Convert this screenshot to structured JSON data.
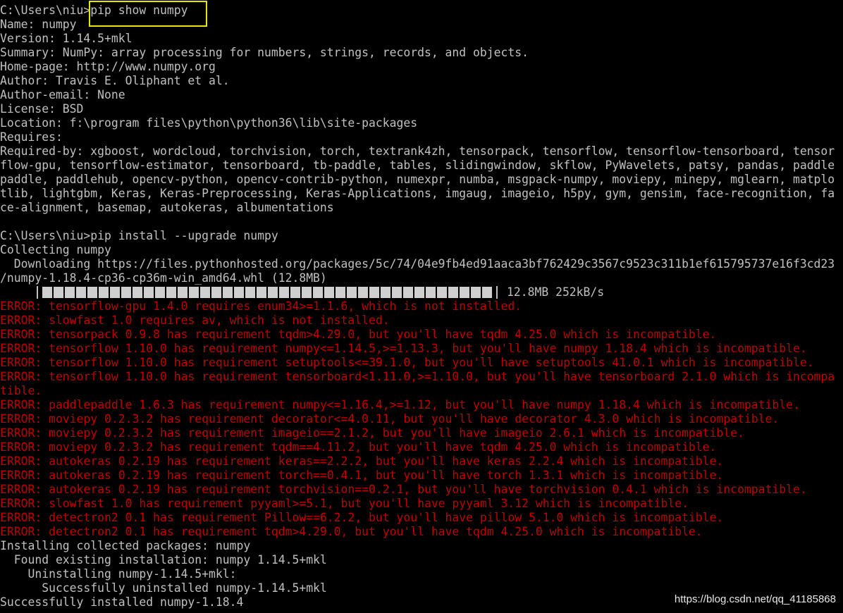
{
  "terminal": {
    "lines": [
      {
        "text": "C:\\Users\\niu>pip show numpy",
        "kind": "normal"
      },
      {
        "text": "Name: numpy",
        "kind": "normal"
      },
      {
        "text": "Version: 1.14.5+mkl",
        "kind": "normal"
      },
      {
        "text": "Summary: NumPy: array processing for numbers, strings, records, and objects.",
        "kind": "normal"
      },
      {
        "text": "Home-page: http://www.numpy.org",
        "kind": "normal"
      },
      {
        "text": "Author: Travis E. Oliphant et al.",
        "kind": "normal"
      },
      {
        "text": "Author-email: None",
        "kind": "normal"
      },
      {
        "text": "License: BSD",
        "kind": "normal"
      },
      {
        "text": "Location: f:\\program files\\python\\python36\\lib\\site-packages",
        "kind": "normal"
      },
      {
        "text": "Requires:",
        "kind": "normal"
      },
      {
        "text": "Required-by: xgboost, wordcloud, torchvision, torch, textrank4zh, tensorpack, tensorflow, tensorflow-tensorboard, tensor",
        "kind": "normal"
      },
      {
        "text": "flow-gpu, tensorflow-estimator, tensorboard, tb-paddle, tables, slidingwindow, skflow, PyWavelets, patsy, pandas, paddle",
        "kind": "normal"
      },
      {
        "text": "paddle, paddlehub, opencv-python, opencv-contrib-python, numexpr, numba, msgpack-numpy, moviepy, minepy, mglearn, matplo",
        "kind": "normal"
      },
      {
        "text": "tlib, lightgbm, Keras, Keras-Preprocessing, Keras-Applications, imgaug, imageio, h5py, gym, gensim, face-recognition, fa",
        "kind": "normal"
      },
      {
        "text": "ce-alignment, basemap, autokeras, albumentations",
        "kind": "normal"
      },
      {
        "text": "",
        "kind": "normal"
      },
      {
        "text": "C:\\Users\\niu>pip install --upgrade numpy",
        "kind": "normal"
      },
      {
        "text": "Collecting numpy",
        "kind": "normal"
      },
      {
        "text": "  Downloading https://files.pythonhosted.org/packages/5c/74/04e9fb4ed91aaca3bf762429c3567c9523c311b1ef615795737e16f3cd23",
        "kind": "normal"
      },
      {
        "text": "/numpy-1.18.4-cp36-cp36m-win_amd64.whl (12.8MB)",
        "kind": "normal"
      },
      {
        "text": "",
        "kind": "progress"
      },
      {
        "text": "ERROR: tensorflow-gpu 1.4.0 requires enum34>=1.1.6, which is not installed.",
        "kind": "error"
      },
      {
        "text": "ERROR: slowfast 1.0 requires av, which is not installed.",
        "kind": "error"
      },
      {
        "text": "ERROR: tensorpack 0.9.8 has requirement tqdm>4.29.0, but you'll have tqdm 4.25.0 which is incompatible.",
        "kind": "error"
      },
      {
        "text": "ERROR: tensorflow 1.10.0 has requirement numpy<=1.14.5,>=1.13.3, but you'll have numpy 1.18.4 which is incompatible.",
        "kind": "error"
      },
      {
        "text": "ERROR: tensorflow 1.10.0 has requirement setuptools<=39.1.0, but you'll have setuptools 41.0.1 which is incompatible.",
        "kind": "error"
      },
      {
        "text": "ERROR: tensorflow 1.10.0 has requirement tensorboard<1.11.0,>=1.10.0, but you'll have tensorboard 2.1.0 which is incompa",
        "kind": "error"
      },
      {
        "text": "tible.",
        "kind": "error"
      },
      {
        "text": "ERROR: paddlepaddle 1.6.3 has requirement numpy<=1.16.4,>=1.12, but you'll have numpy 1.18.4 which is incompatible.",
        "kind": "error"
      },
      {
        "text": "ERROR: moviepy 0.2.3.2 has requirement decorator<=4.0.11, but you'll have decorator 4.3.0 which is incompatible.",
        "kind": "error"
      },
      {
        "text": "ERROR: moviepy 0.2.3.2 has requirement imageio==2.1.2, but you'll have imageio 2.6.1 which is incompatible.",
        "kind": "error"
      },
      {
        "text": "ERROR: moviepy 0.2.3.2 has requirement tqdm==4.11.2, but you'll have tqdm 4.25.0 which is incompatible.",
        "kind": "error"
      },
      {
        "text": "ERROR: autokeras 0.2.19 has requirement keras==2.2.2, but you'll have keras 2.2.4 which is incompatible.",
        "kind": "error"
      },
      {
        "text": "ERROR: autokeras 0.2.19 has requirement torch==0.4.1, but you'll have torch 1.3.1 which is incompatible.",
        "kind": "error"
      },
      {
        "text": "ERROR: autokeras 0.2.19 has requirement torchvision==0.2.1, but you'll have torchvision 0.4.1 which is incompatible.",
        "kind": "error"
      },
      {
        "text": "ERROR: slowfast 1.0 has requirement pyyaml>=5.1, but you'll have pyyaml 3.12 which is incompatible.",
        "kind": "error"
      },
      {
        "text": "ERROR: detectron2 0.1 has requirement Pillow==6.2.2, but you'll have pillow 5.1.0 which is incompatible.",
        "kind": "error"
      },
      {
        "text": "ERROR: detectron2 0.1 has requirement tqdm>4.29.0, but you'll have tqdm 4.25.0 which is incompatible.",
        "kind": "error"
      },
      {
        "text": "Installing collected packages: numpy",
        "kind": "normal"
      },
      {
        "text": "  Found existing installation: numpy 1.14.5+mkl",
        "kind": "normal"
      },
      {
        "text": "    Uninstalling numpy-1.14.5+mkl:",
        "kind": "normal"
      },
      {
        "text": "      Successfully uninstalled numpy-1.14.5+mkl",
        "kind": "normal"
      },
      {
        "text": "Successfully installed numpy-1.18.4",
        "kind": "normal"
      }
    ],
    "progress": {
      "fraction": 1.0,
      "text": "12.8MB 252kB/s"
    }
  },
  "highlight": {
    "text": "pip show numpy",
    "color": "#e6e600"
  },
  "watermark": "https://blog.csdn.net/qq_41185868",
  "colors": {
    "background": "#000000",
    "text": "#c0c0c0",
    "error": "#c00000"
  }
}
